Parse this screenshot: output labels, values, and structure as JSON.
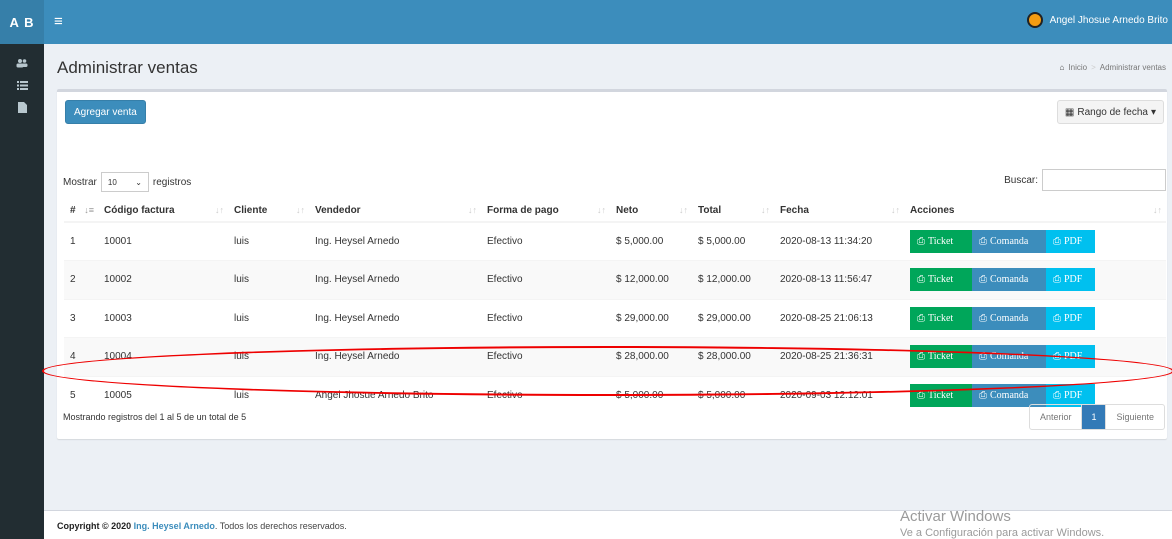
{
  "header": {
    "logo": "A B",
    "user_name": "Angel Jhosue Arnedo Brito"
  },
  "sidebar": {
    "items": [
      {
        "icon": "users-icon"
      },
      {
        "icon": "list-icon"
      },
      {
        "icon": "file-icon"
      }
    ]
  },
  "page": {
    "title": "Administrar ventas",
    "breadcrumb": {
      "home": "Inicio",
      "current": "Administrar ventas"
    }
  },
  "toolbar": {
    "add_label": "Agregar venta",
    "range_label": "Rango de fecha"
  },
  "datatable": {
    "length_prefix": "Mostrar",
    "length_value": "10",
    "length_suffix": "registros",
    "search_label": "Buscar:",
    "columns": [
      "#",
      "Código factura",
      "Cliente",
      "Vendedor",
      "Forma de pago",
      "Neto",
      "Total",
      "Fecha",
      "Acciones"
    ],
    "rows": [
      {
        "n": "1",
        "code": "10001",
        "client": "luis",
        "seller": "Ing. Heysel Arnedo",
        "pay": "Efectivo",
        "net": "$ 5,000.00",
        "total": "$ 5,000.00",
        "date": "2020-08-13 11:34:20"
      },
      {
        "n": "2",
        "code": "10002",
        "client": "luis",
        "seller": "Ing. Heysel Arnedo",
        "pay": "Efectivo",
        "net": "$ 12,000.00",
        "total": "$ 12,000.00",
        "date": "2020-08-13 11:56:47"
      },
      {
        "n": "3",
        "code": "10003",
        "client": "luis",
        "seller": "Ing. Heysel Arnedo",
        "pay": "Efectivo",
        "net": "$ 29,000.00",
        "total": "$ 29,000.00",
        "date": "2020-08-25 21:06:13"
      },
      {
        "n": "4",
        "code": "10004",
        "client": "luis",
        "seller": "Ing. Heysel Arnedo",
        "pay": "Efectivo",
        "net": "$ 28,000.00",
        "total": "$ 28,000.00",
        "date": "2020-08-25 21:36:31"
      },
      {
        "n": "5",
        "code": "10005",
        "client": "luis",
        "seller": "Angel Jhosue Arnedo Brito",
        "pay": "Efectivo",
        "net": "$ 5,000.00",
        "total": "$ 5,000.00",
        "date": "2020-09-03 12:12:01"
      }
    ],
    "actions": {
      "ticket": "Ticket",
      "comanda": "Comanda",
      "pdf": "PDF"
    },
    "info": "Mostrando registros del 1 al 5 de un total de 5",
    "pager": {
      "prev": "Anterior",
      "page": "1",
      "next": "Siguiente"
    }
  },
  "footer": {
    "prefix": "Copyright © 2020",
    "link": "Ing. Heysel Arnedo",
    "suffix": ". Todos los derechos reservados."
  },
  "watermark": {
    "line1": "Activar Windows",
    "line2": "Ve a Configuración para activar Windows."
  },
  "colors": {
    "primary": "#3c8dbc",
    "success": "#00a65a",
    "info": "#00c0ef",
    "sidebar": "#222d32",
    "annotation": "#e00000"
  }
}
